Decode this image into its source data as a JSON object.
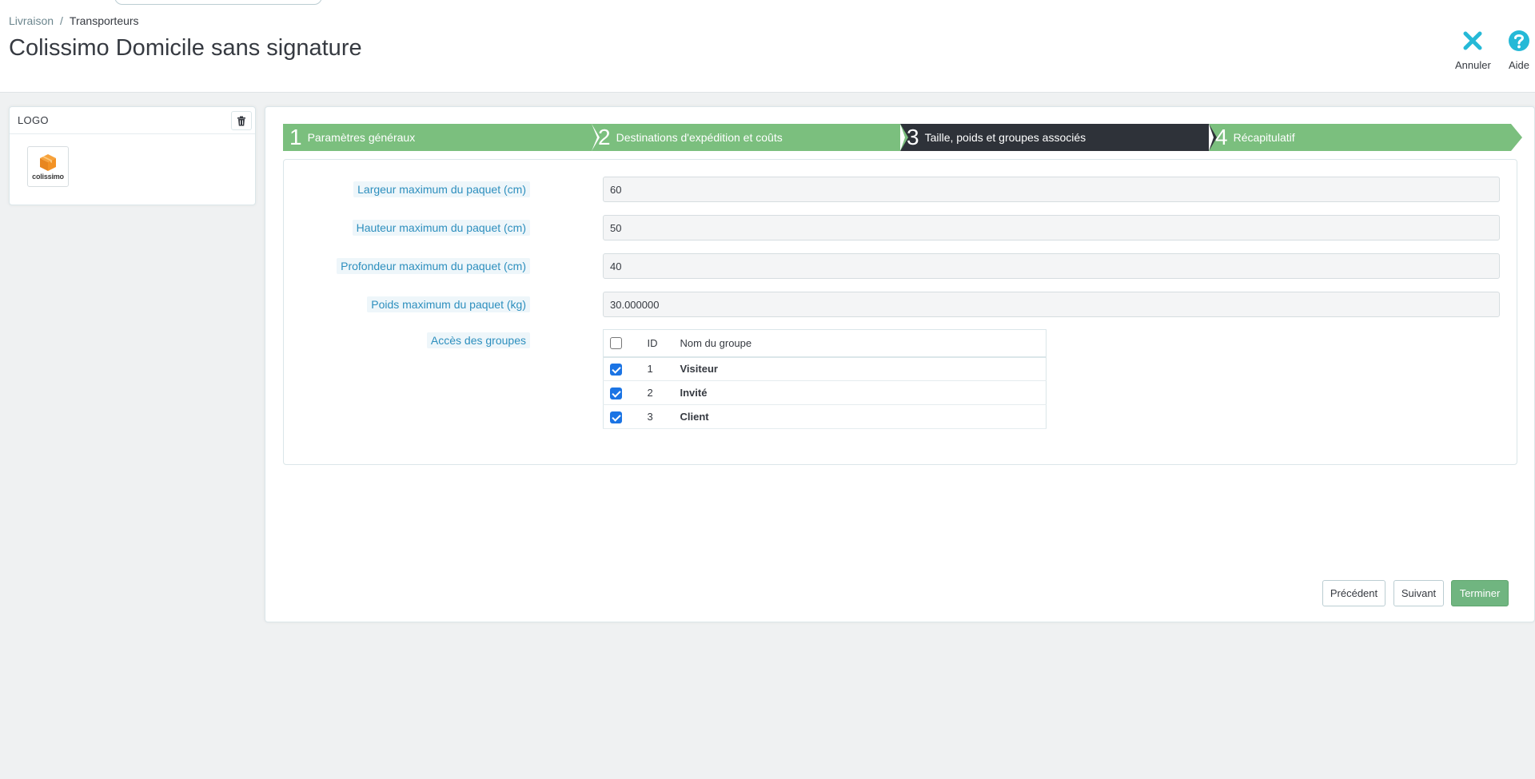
{
  "breadcrumb": {
    "parent": "Livraison",
    "separator": "/",
    "current": "Transporteurs"
  },
  "page_title": "Colissimo Domicile sans signature",
  "toolbar": {
    "cancel_label": "Annuler",
    "help_label": "Aide",
    "accent_color": "#25b9d7"
  },
  "logo_panel": {
    "title": "LOGO",
    "carrier_logo_text": "colissimo",
    "delete_icon": "trash-icon"
  },
  "wizard": {
    "steps": [
      {
        "number": "1",
        "label": "Paramètres généraux",
        "state": "done"
      },
      {
        "number": "2",
        "label": "Destinations d'expédition et coûts",
        "state": "done"
      },
      {
        "number": "3",
        "label": "Taille, poids et groupes associés",
        "state": "active"
      },
      {
        "number": "4",
        "label": "Récapitulatif",
        "state": "done"
      }
    ]
  },
  "form": {
    "fields": [
      {
        "label": "Largeur maximum du paquet (cm)",
        "value": "60"
      },
      {
        "label": "Hauteur maximum du paquet (cm)",
        "value": "50"
      },
      {
        "label": "Profondeur maximum du paquet (cm)",
        "value": "40"
      },
      {
        "label": "Poids maximum du paquet (kg)",
        "value": "30.000000"
      }
    ],
    "groups": {
      "label": "Accès des groupes",
      "columns": {
        "id": "ID",
        "name": "Nom du groupe"
      },
      "select_all_checked": false,
      "rows": [
        {
          "id": "1",
          "name": "Visiteur",
          "checked": true
        },
        {
          "id": "2",
          "name": "Invité",
          "checked": true
        },
        {
          "id": "3",
          "name": "Client",
          "checked": true
        }
      ]
    }
  },
  "buttons": {
    "previous": "Précédent",
    "next": "Suivant",
    "finish": "Terminer"
  },
  "colors": {
    "step_done": "#7bbf7e",
    "step_active": "#2e3239",
    "primary_button": "#70b580",
    "checkbox_checked": "#1b74e4"
  }
}
